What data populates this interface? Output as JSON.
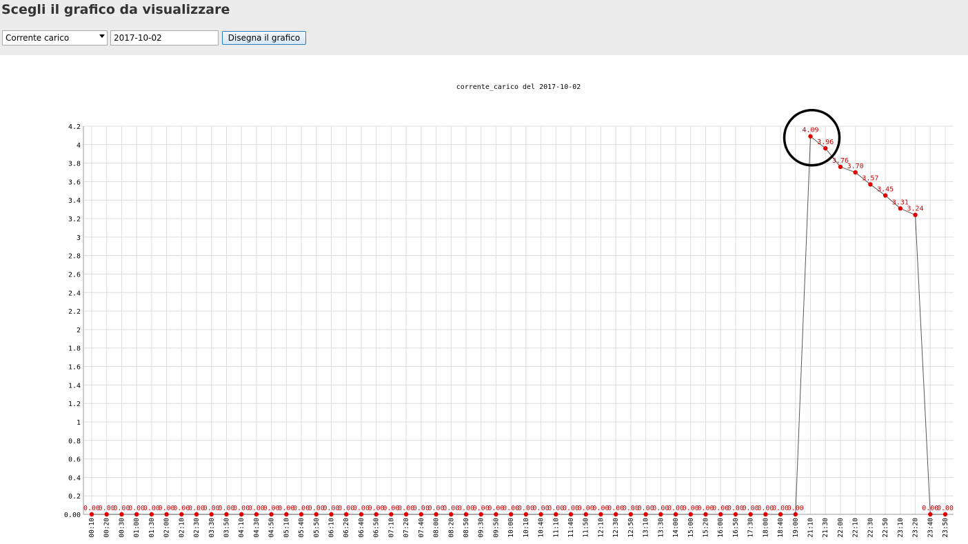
{
  "header": {
    "title": "Scegli il grafico da visualizzare",
    "metric_select_value": "Corrente carico",
    "date_value": "2017-10-02",
    "draw_button_label": "Disegna il grafico"
  },
  "colors": {
    "header_bg": "#ececec",
    "point": "#e00000",
    "label": "#cc0000",
    "line": "#555555",
    "grid": "#dcdcdc",
    "circle": "#000000"
  },
  "chart_data": {
    "type": "line",
    "title": "corrente_carico del 2017-10-02",
    "ylim": [
      0,
      4.2
    ],
    "y_ticks": [
      "0.00",
      "0.2",
      "0.4",
      "0.6",
      "0.8",
      "1",
      "1.2",
      "1.4",
      "1.6",
      "1.8",
      "2",
      "2.2",
      "2.4",
      "2.6",
      "2.8",
      "3",
      "3.2",
      "3.4",
      "3.6",
      "3.8",
      "4",
      "4.2"
    ],
    "grid": true,
    "categories": [
      "00:10",
      "00:20",
      "00:30",
      "01:00",
      "01:30",
      "02:00",
      "02:10",
      "02:30",
      "03:30",
      "03:50",
      "04:10",
      "04:30",
      "04:50",
      "05:10",
      "05:40",
      "05:50",
      "06:10",
      "06:20",
      "06:40",
      "06:50",
      "07:10",
      "07:20",
      "07:40",
      "08:00",
      "08:20",
      "08:50",
      "09:30",
      "09:50",
      "10:00",
      "10:10",
      "10:40",
      "11:10",
      "11:40",
      "11:50",
      "12:10",
      "12:30",
      "12:50",
      "13:10",
      "13:30",
      "14:00",
      "15:00",
      "15:20",
      "16:00",
      "16:50",
      "17:30",
      "18:00",
      "18:40",
      "19:00",
      "21:10",
      "21:30",
      "22:00",
      "22:10",
      "22:30",
      "22:50",
      "23:10",
      "23:20",
      "23:40",
      "23:50"
    ],
    "values": [
      0,
      0,
      0,
      0,
      0,
      0,
      0,
      0,
      0,
      0,
      0,
      0,
      0,
      0,
      0,
      0,
      0,
      0,
      0,
      0,
      0,
      0,
      0,
      0,
      0,
      0,
      0,
      0,
      0,
      0,
      0,
      0,
      0,
      0,
      0,
      0,
      0,
      0,
      0,
      0,
      0,
      0,
      0,
      0,
      0,
      0,
      0,
      0,
      4.09,
      3.96,
      3.76,
      3.7,
      3.57,
      3.45,
      3.31,
      3.24,
      0,
      0
    ],
    "point_labels": [
      "0.00",
      "0.00",
      "0.00",
      "0.00",
      "0.00",
      "0.00",
      "0.00",
      "0.00",
      "0.00",
      "0.00",
      "0.00",
      "0.00",
      "0.00",
      "0.00",
      "0.00",
      "0.00",
      "0.00",
      "0.00",
      "0.00",
      "0.00",
      "0.00",
      "0.00",
      "0.00",
      "0.00",
      "0.00",
      "0.00",
      "0.00",
      "0.00",
      "0.00",
      "0.00",
      "0.00",
      "0.00",
      "0.00",
      "0.00",
      "0.00",
      "0.00",
      "0.00",
      "0.00",
      "0.00",
      "0.00",
      "0.00",
      "0.00",
      "0.00",
      "0.00",
      "0.00",
      "0.00",
      "0.00",
      "0.00",
      "4.09",
      "3.96",
      "3.76",
      "3.70",
      "3.57",
      "3.45",
      "3.31",
      "3.24",
      "0.00",
      "0.00"
    ],
    "highlight_index": 48
  }
}
